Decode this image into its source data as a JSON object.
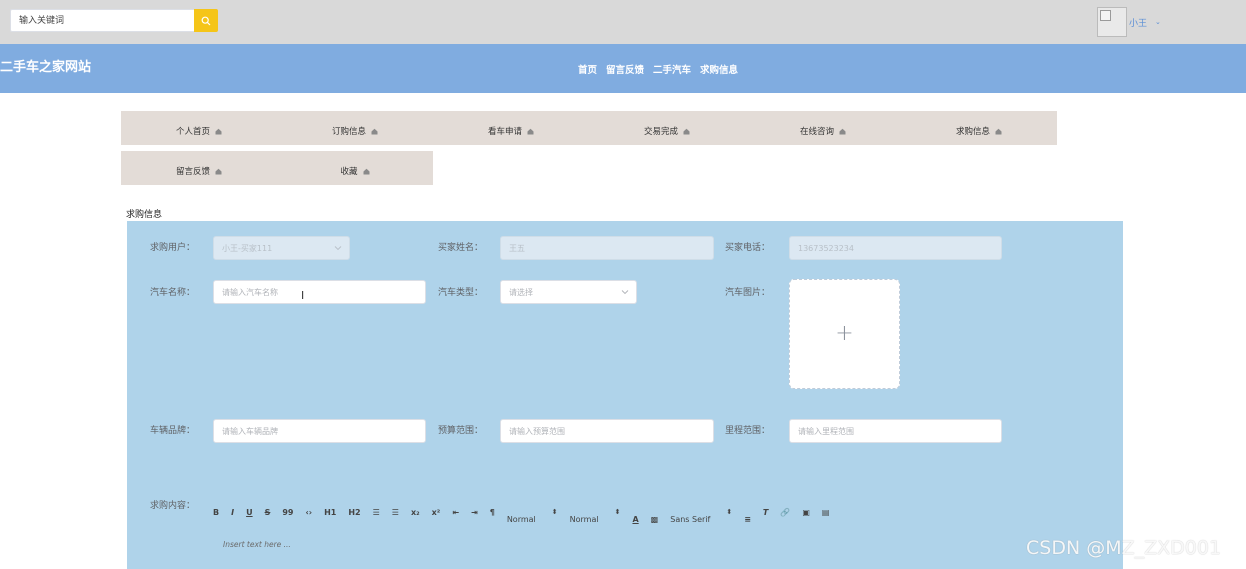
{
  "header": {
    "search": {
      "placeholder": "输入关键词",
      "value": ""
    },
    "user": {
      "name": "小王"
    }
  },
  "nav": {
    "site_title": "二手车之家网站",
    "links": [
      "首页",
      "留言反馈",
      "二手汽车",
      "求购信息"
    ]
  },
  "side_menu": {
    "row1": [
      "个人首页",
      "订购信息",
      "看车申请",
      "交易完成",
      "在线咨询",
      "求购信息"
    ],
    "row2": [
      "留言反馈",
      "收藏"
    ]
  },
  "form": {
    "section_title": "求购信息",
    "buyer_user": {
      "label": "求购用户：",
      "value": "小王-买家111"
    },
    "buyer_name": {
      "label": "买家姓名：",
      "value": "王五"
    },
    "buyer_phone": {
      "label": "买家电话：",
      "value": "13673523234"
    },
    "car_name": {
      "label": "汽车名称：",
      "placeholder": "请输入汽车名称"
    },
    "car_type": {
      "label": "汽车类型：",
      "placeholder": "请选择"
    },
    "car_image": {
      "label": "汽车图片："
    },
    "brand": {
      "label": "车辆品牌：",
      "placeholder": "请输入车辆品牌"
    },
    "budget": {
      "label": "预算范围：",
      "placeholder": "请输入预算范围"
    },
    "mileage": {
      "label": "里程范围：",
      "placeholder": "请输入里程范围"
    },
    "content": {
      "label": "求购内容：",
      "placeholder": "Insert text here ..."
    }
  },
  "editor": {
    "buttons": [
      "B",
      "I",
      "U",
      "S",
      "99",
      "‹›",
      "H1",
      "H2",
      "☰",
      "☰",
      "x₂",
      "x²",
      "⇤",
      "⇥",
      "¶"
    ],
    "size_select": "Normal",
    "header_select": "Normal",
    "font_select": "Sans Serif"
  },
  "watermark": "CSDN @MZ_ZXD001",
  "colors": {
    "nav_bg": "#80ace0",
    "topbar_bg": "#d9d9d9",
    "form_bg": "#afd3ea",
    "menu_bg": "#e3dcd7",
    "search_btn": "#f5c518"
  }
}
